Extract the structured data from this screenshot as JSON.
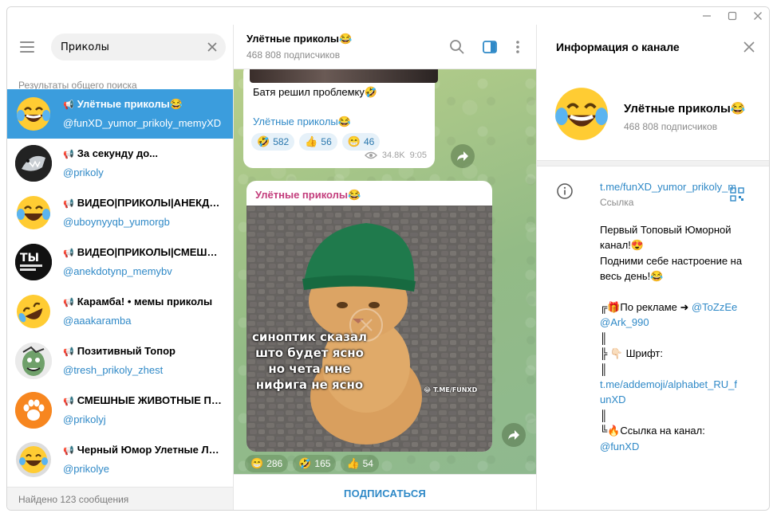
{
  "window": {
    "minimize_icon": "minimize-icon",
    "maximize_icon": "maximize-icon",
    "close_icon": "close-icon"
  },
  "search": {
    "value": "Приколы",
    "section_label": "Результаты общего поиска",
    "found_text": "Найдено 123 сообщения"
  },
  "results": [
    {
      "title": "Улётные приколы😂",
      "handle": "@funXD_yumor_prikoly_memyXD"
    },
    {
      "title": "За секунду до...",
      "handle": "@prikoly"
    },
    {
      "title": "ВИДЕО|ПРИКОЛЫ|АНЕКДОТЫ",
      "handle": "@uboynyyqb_yumorgb"
    },
    {
      "title": "ВИДЕО|ПРИКОЛЫ|СМЕШНОЕ",
      "handle": "@anekdotynp_memybv"
    },
    {
      "title": "Карамба! • мемы приколы",
      "handle": "@aaakaramba"
    },
    {
      "title": "Позитивный Топор",
      "handle": "@tresh_prikoly_zhest"
    },
    {
      "title": "СМЕШНЫЕ ЖИВОТНЫЕ ПРИКОЛЫ",
      "handle": "@prikolyj"
    },
    {
      "title": "Черный Юмор Улетные Люди",
      "handle": "@prikolye"
    }
  ],
  "chat": {
    "title": "Улётные приколы😂",
    "subscribers": "468 808 подписчиков",
    "message1": {
      "text": "Батя решил проблемку🤣",
      "link": "Улётные приколы😂",
      "reactions": [
        {
          "emoji": "🤣",
          "count": "582"
        },
        {
          "emoji": "👍",
          "count": "56"
        },
        {
          "emoji": "😁",
          "count": "46"
        }
      ],
      "views": "34.8K",
      "time": "9:05"
    },
    "message2": {
      "author": "Улётные приколы😂",
      "caption_lines": [
        "синоптик сказал",
        "што будет ясно",
        "но чета мне",
        "нифига не ясно"
      ],
      "watermark": "T.ME/FUNXD",
      "reactions": [
        {
          "emoji": "😁",
          "count": "286"
        },
        {
          "emoji": "🤣",
          "count": "165"
        },
        {
          "emoji": "👍",
          "count": "54"
        }
      ]
    },
    "subscribe_label": "ПОДПИСАТЬСЯ"
  },
  "info": {
    "title": "Информация о канале",
    "name": "Улётные приколы😂",
    "subscribers": "468 808 подписчиков",
    "link": "t.me/funXD_yumor_prikoly_memyXD",
    "link_label": "Ссылка",
    "description": {
      "l1": "Первый Топовый Юморной",
      "l2": "канал!😍",
      "l3": "Подними себе настроение на",
      "l4": "весь день!😂",
      "l6": "╔🎁По рекламе ➜ ",
      "l6_link": "@ToZzEe",
      "l7_link": "@Ark_990",
      "l8": "║",
      "l9": "╠ 👇🏻 Шрифт:",
      "l10": "║",
      "l11_link": "t.me/addemoji/alphabet_RU_f",
      "l12_link": "unXD",
      "l13": "║",
      "l14": "╚🔥Ссылка на канал:",
      "l15_link": "@funXD"
    }
  }
}
